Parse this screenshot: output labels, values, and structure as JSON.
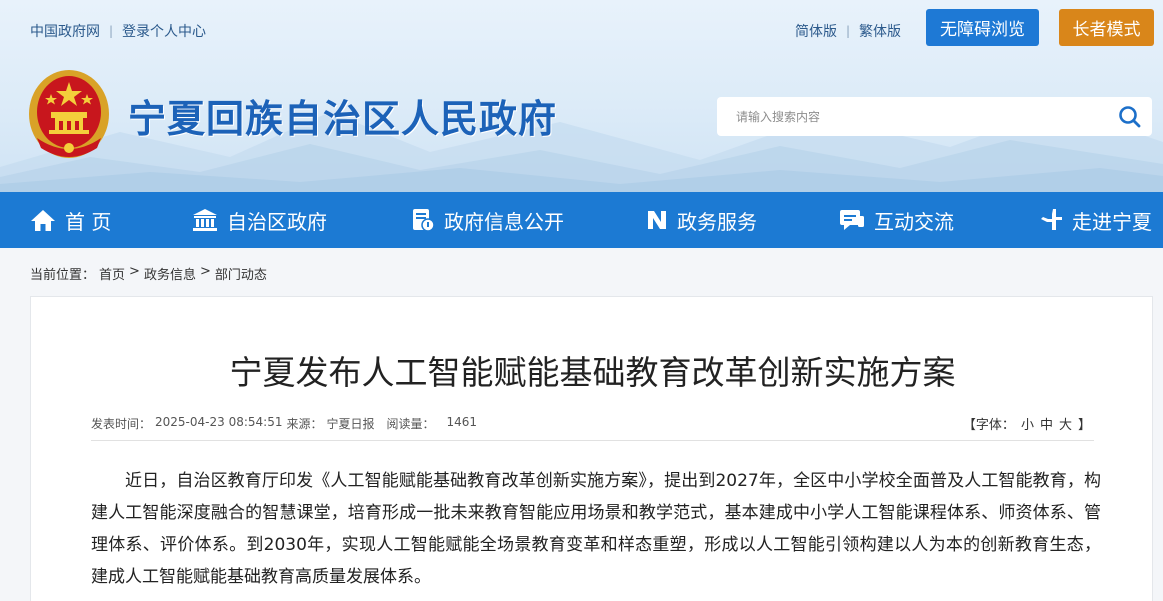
{
  "top_links": {
    "gov_portal": "中国政府网",
    "login": "登录个人中心"
  },
  "lang": {
    "simplified": "简体版",
    "traditional": "繁体版"
  },
  "buttons": {
    "accessible": "无障碍浏览",
    "elder_mode": "长者模式"
  },
  "site_title": "宁夏回族自治区人民政府",
  "search": {
    "placeholder": "请输入搜索内容"
  },
  "nav": {
    "items": [
      {
        "label": "首 页",
        "icon": "home-icon"
      },
      {
        "label": "自治区政府",
        "icon": "government-building-icon"
      },
      {
        "label": "政府信息公开",
        "icon": "document-info-icon"
      },
      {
        "label": "政务服务",
        "icon": "service-n-icon"
      },
      {
        "label": "互动交流",
        "icon": "chat-icon"
      },
      {
        "label": "走进宁夏",
        "icon": "hand-icon"
      }
    ]
  },
  "breadcrumb": {
    "prefix": "当前位置：",
    "items": [
      "首页",
      "政务信息",
      "部门动态"
    ],
    "separator": ">"
  },
  "article": {
    "title": "宁夏发布人工智能赋能基础教育改革创新实施方案",
    "meta": {
      "time_label": "发表时间：",
      "time": "2025-04-23 08:54:51",
      "source_label": "来源：",
      "source": "宁夏日报",
      "reads_label": "阅读量：",
      "reads": "1461"
    },
    "font_size": {
      "open": "【字体：",
      "small": "小",
      "medium": "中",
      "large": "大",
      "close": "】"
    },
    "paragraph": "近日，自治区教育厅印发《人工智能赋能基础教育改革创新实施方案》，提出到2027年，全区中小学校全面普及人工智能教育，构建人工智能深度融合的智慧课堂，培育形成一批未来教育智能应用场景和教学范式，基本建成中小学人工智能课程体系、师资体系、管理体系、评价体系。到2030年，实现人工智能赋能全场景教育变革和样态重塑，形成以人工智能引领构建以人为本的创新教育生态，建成人工智能赋能基础教育高质量发展体系。"
  },
  "colors": {
    "nav_blue": "#1c7ad3",
    "title_blue": "#1c62b8",
    "access_btn": "#1e79d5",
    "elder_btn": "#d9861a"
  }
}
